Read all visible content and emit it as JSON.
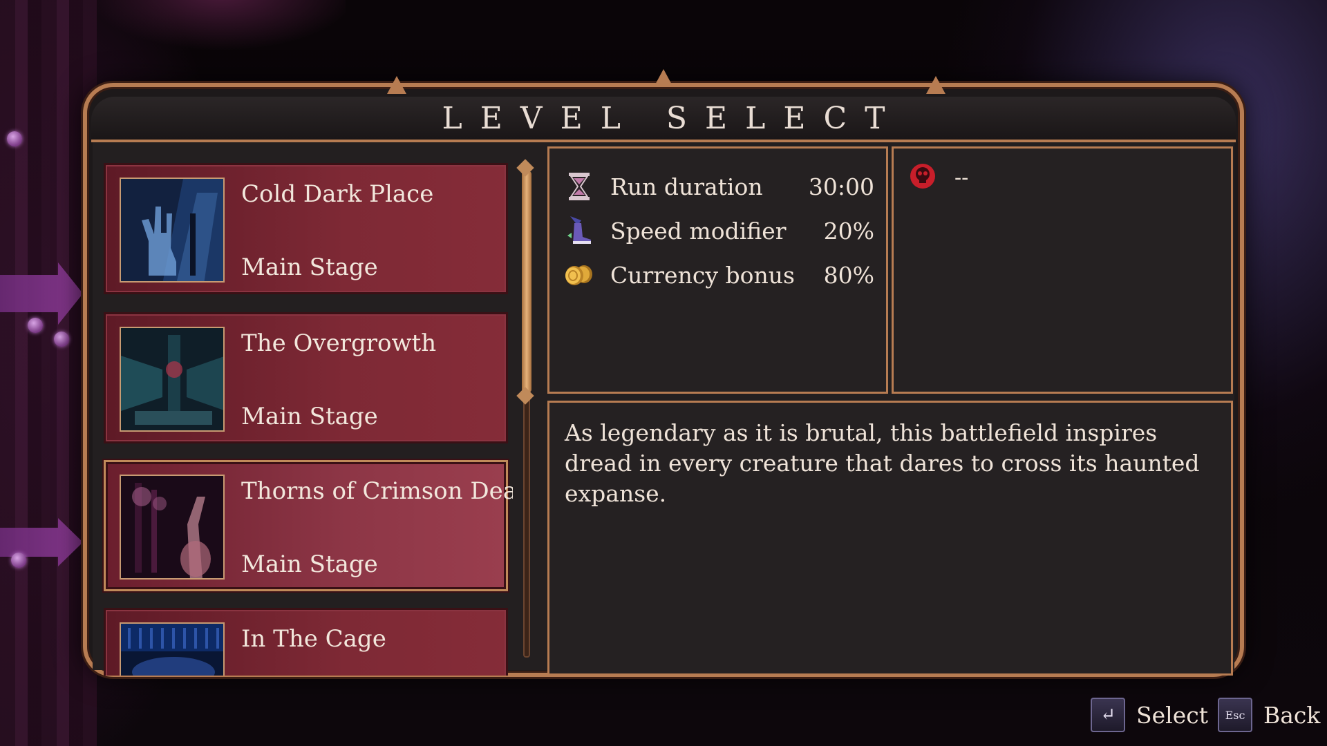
{
  "title": "LEVEL SELECT",
  "levels": [
    {
      "name": "Cold Dark Place",
      "stage": "Main Stage",
      "thumb_colors": [
        "#1d3a6a",
        "#4f86c9",
        "#12213f"
      ]
    },
    {
      "name": "The Overgrowth",
      "stage": "Main Stage",
      "thumb_colors": [
        "#1b3e49",
        "#3fa3b0",
        "#0f1e28"
      ]
    },
    {
      "name": "Thorns of Crimson Death",
      "stage": "Main Stage",
      "thumb_colors": [
        "#3a1430",
        "#a05a86",
        "#1a0a18"
      ]
    },
    {
      "name": "In The Cage",
      "stage": "",
      "thumb_colors": [
        "#0d2a66",
        "#3b67c5",
        "#091634"
      ]
    }
  ],
  "selected_index": 2,
  "stats": [
    {
      "icon": "hourglass-icon",
      "label": "Run duration",
      "value": "30:00"
    },
    {
      "icon": "speed-boot-icon",
      "label": "Speed modifier",
      "value": "20%"
    },
    {
      "icon": "coins-icon",
      "label": "Currency bonus",
      "value": "80%"
    }
  ],
  "record": {
    "icon": "skull-icon",
    "value": "--"
  },
  "description": "As legendary as it is brutal, this battlefield inspires dread in every creature that dares to cross its haunted expanse.",
  "prompts": {
    "select": {
      "key": "↵",
      "label": "Select"
    },
    "back": {
      "key": "Esc",
      "label": "Back"
    }
  },
  "colors": {
    "frame": "#b77c52",
    "card": "#7e2935",
    "skull": "#c81e2a"
  }
}
